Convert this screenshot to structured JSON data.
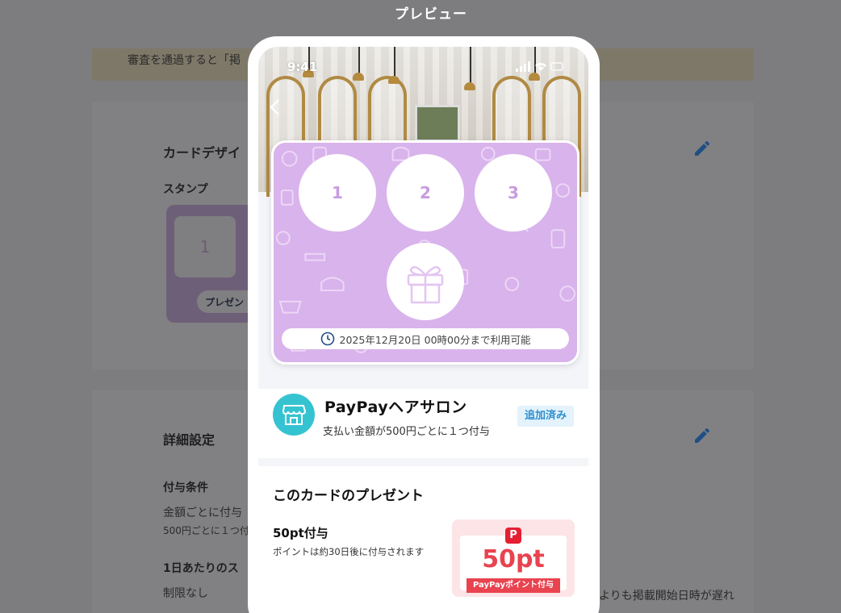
{
  "modal": {
    "title": "プレビュー"
  },
  "background": {
    "notice": "審査を通過すると「掲",
    "design_panel": {
      "heading": "カードデザイ",
      "stamp_label": "スタンプ",
      "mini_stamp_number": "1",
      "mini_present_label": "プレゼン"
    },
    "detail_panel": {
      "heading": "詳細設定",
      "grant_condition_label": "付与条件",
      "grant_condition_value": "金額ごとに付与",
      "grant_condition_detail": "500円ごとに１つ付",
      "daily_limit_label": "1日あたりのス",
      "daily_limit_value": "制限なし",
      "right_text": "よりも掲載開始日時が遅れ"
    },
    "accent_color": "#2d6cb5"
  },
  "phone": {
    "status_time": "9:41",
    "stamps": [
      "1",
      "2",
      "3"
    ],
    "gift_icon": "gift-icon",
    "expiry": "2025年12月20日 00時00分まで利用可能",
    "card_color": "#d9b3ec",
    "shop": {
      "name": "PayPayヘアサロン",
      "description": "支払い金額が500円ごとに１つ付与",
      "status": "追加済み",
      "logo_icon": "storefront-icon",
      "logo_color": "#35c3d1"
    },
    "present": {
      "section_title": "このカードのプレゼント",
      "name": "50pt付与",
      "note": "ポイントは約30日後に付与されます",
      "points_value": "50pt",
      "badge_label": "PayPayポイント付与",
      "logo_glyph": "P"
    }
  }
}
